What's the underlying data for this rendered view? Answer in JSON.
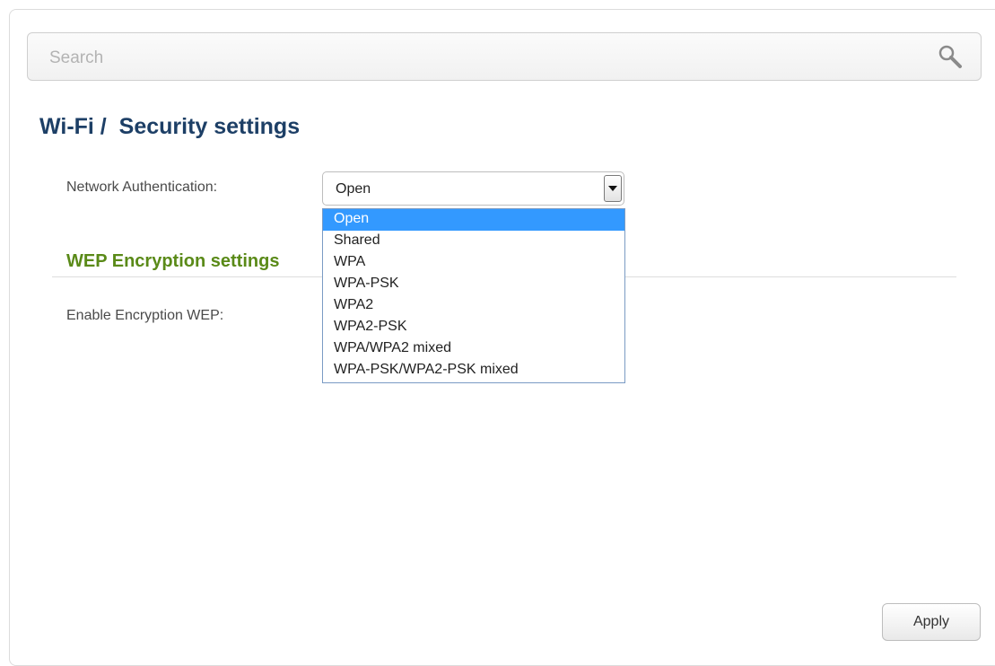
{
  "search": {
    "placeholder": "Search",
    "icon": "search-icon"
  },
  "page": {
    "title": "Wi-Fi /  Security settings"
  },
  "form": {
    "network_auth_label": "Network Authentication:",
    "network_auth_value": "Open",
    "network_auth_options": [
      "Open",
      "Shared",
      "WPA",
      "WPA-PSK",
      "WPA2",
      "WPA2-PSK",
      "WPA/WPA2 mixed",
      "WPA-PSK/WPA2-PSK mixed"
    ],
    "selected_option_index": 0
  },
  "wep_section": {
    "title": "WEP Encryption settings",
    "enable_label": "Enable Encryption WEP:"
  },
  "actions": {
    "apply_label": "Apply"
  },
  "colors": {
    "title": "#1d3f66",
    "section_title": "#5a8a18",
    "selected_option_bg": "#3399ff"
  }
}
